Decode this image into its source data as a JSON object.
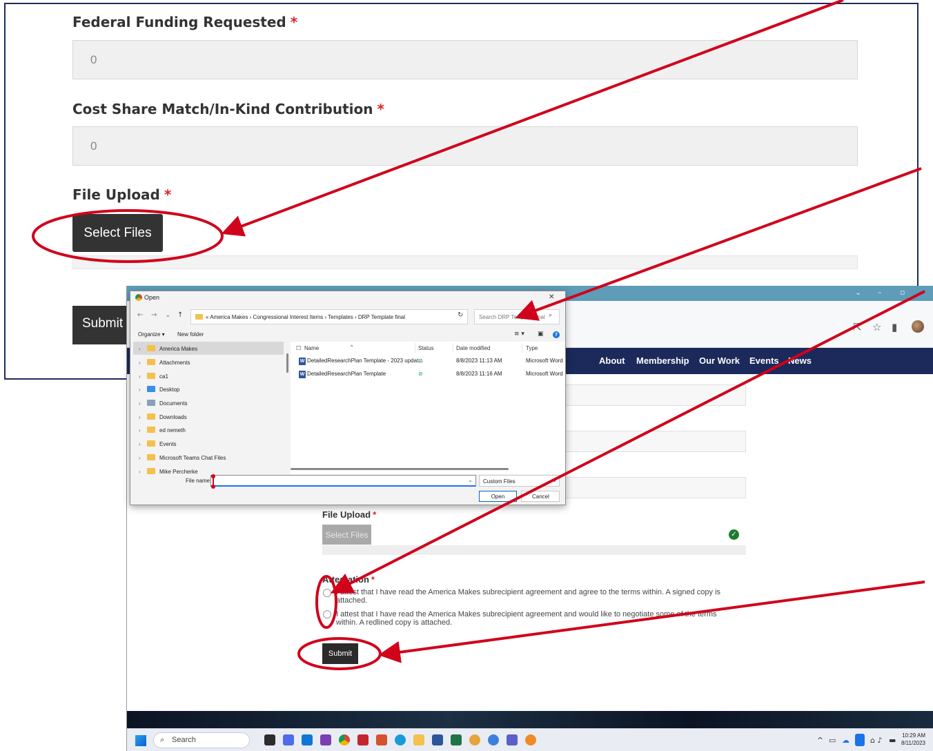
{
  "zoom_form": {
    "federal_label": "Federal Funding Requested",
    "federal_value": "0",
    "cost_share_label": "Cost Share Match/In-Kind Contribution",
    "cost_share_value": "0",
    "file_upload_label": "File Upload",
    "required_marker": "*",
    "select_files_label": "Select Files",
    "submit_label": "Submit"
  },
  "dialog": {
    "title": "Open",
    "breadcrumb": "« America Makes › Congressional Interest Items › Templates › DRP Template final",
    "search_placeholder": "Search DRP Template final",
    "organize_label": "Organize ▾",
    "new_folder_label": "New folder",
    "tree": [
      {
        "label": "America Makes",
        "color": "#f2c14e",
        "selected": true
      },
      {
        "label": "Attachments",
        "color": "#f2c14e"
      },
      {
        "label": "ca1",
        "color": "#f2c14e"
      },
      {
        "label": "Desktop",
        "color": "#3a8ee6"
      },
      {
        "label": "Documents",
        "color": "#8aa0b8"
      },
      {
        "label": "Downloads",
        "color": "#f2c14e"
      },
      {
        "label": "ed nemeth",
        "color": "#f2c14e"
      },
      {
        "label": "Events",
        "color": "#f2c14e"
      },
      {
        "label": "Microsoft Teams Chat Files",
        "color": "#f2c14e"
      },
      {
        "label": "Mike Percherke",
        "color": "#f2c14e"
      }
    ],
    "columns": {
      "name": "Name",
      "status": "Status",
      "date": "Date modified",
      "type": "Type"
    },
    "files": [
      {
        "name": "DetailedResearchPlan Template - 2023 updat...",
        "status": "⊘",
        "date": "8/8/2023 11:13 AM",
        "type": "Microsoft Word"
      },
      {
        "name": "DetailedResearchPlan Template",
        "status": "⊘",
        "date": "8/8/2023 11:16 AM",
        "type": "Microsoft Word"
      }
    ],
    "file_name_label": "File name:",
    "file_type_value": "Custom Files",
    "open_label": "Open",
    "cancel_label": "Cancel"
  },
  "site": {
    "nav": [
      "About",
      "Membership",
      "Our Work",
      "Events",
      "News"
    ],
    "file_upload_label": "File Upload",
    "required_marker": "*",
    "select_files_label": "Select Files",
    "attestation_label": "Attestation",
    "attest_option_1": "I attest that I have read the America Makes subrecipient agreement and agree to the terms within. A signed copy is attached.",
    "attest_option_2": "I attest that I have read the America Makes subrecipient agreement and would like to negotiate some of the terms within. A redlined copy is attached.",
    "submit_label": "Submit"
  },
  "taskbar": {
    "search_label": "Search",
    "time": "10:29 AM",
    "date": "8/11/2023"
  },
  "colors": {
    "annotation_red": "#d0021b",
    "nav_navy": "#1b2a5b",
    "required_red": "#e02424"
  }
}
